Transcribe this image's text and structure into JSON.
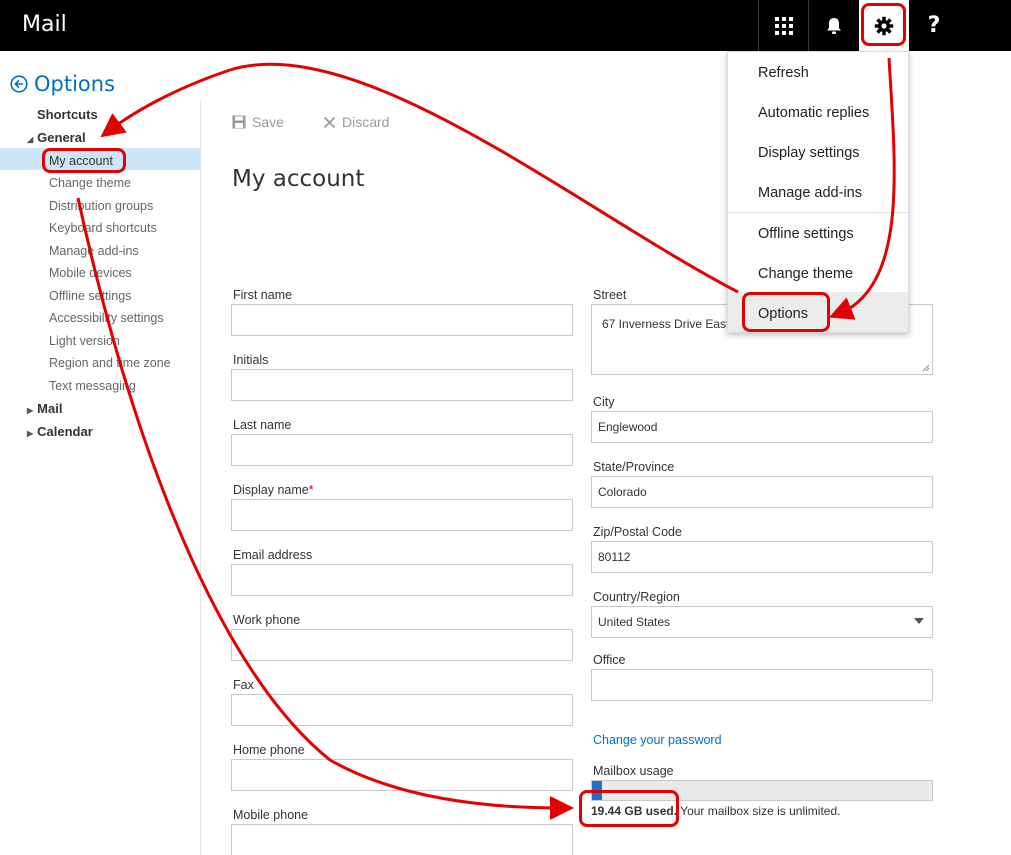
{
  "app": {
    "title": "Mail"
  },
  "topbar": {
    "apps_icon": "app-launcher-icon",
    "notifications_icon": "bell-icon",
    "settings_icon": "gear-icon",
    "help_label": "?"
  },
  "options_header": {
    "label": "Options"
  },
  "nav": {
    "shortcuts": "Shortcuts",
    "general": "General",
    "general_items": [
      "My account",
      "Change theme",
      "Distribution groups",
      "Keyboard shortcuts",
      "Manage add-ins",
      "Mobile devices",
      "Offline settings",
      "Accessibility settings",
      "Light version",
      "Region and time zone",
      "Text messaging"
    ],
    "mail": "Mail",
    "calendar": "Calendar"
  },
  "toolbar": {
    "save_label": "Save",
    "discard_label": "Discard"
  },
  "page": {
    "title": "My account"
  },
  "form_left": {
    "first_name": {
      "label": "First name",
      "value": ""
    },
    "initials": {
      "label": "Initials",
      "value": ""
    },
    "last_name": {
      "label": "Last name",
      "value": ""
    },
    "display_name": {
      "label": "Display name",
      "required_mark": "*",
      "value": ""
    },
    "email": {
      "label": "Email address",
      "value": ""
    },
    "work_phone": {
      "label": "Work phone",
      "value": ""
    },
    "fax": {
      "label": "Fax",
      "value": ""
    },
    "home_phone": {
      "label": "Home phone",
      "value": ""
    },
    "mobile_phone": {
      "label": "Mobile phone",
      "value": ""
    }
  },
  "form_right": {
    "street": {
      "label": "Street",
      "value": "67 Inverness Drive East"
    },
    "city": {
      "label": "City",
      "value": "Englewood"
    },
    "state": {
      "label": "State/Province",
      "value": "Colorado"
    },
    "zip": {
      "label": "Zip/Postal Code",
      "value": "80112"
    },
    "country": {
      "label": "Country/Region",
      "value": "United States"
    },
    "office": {
      "label": "Office",
      "value": ""
    },
    "change_password": "Change your password",
    "mailbox_usage_label": "Mailbox usage",
    "mailbox_used": "19.44 GB used.",
    "mailbox_unlimited": "Your mailbox size is unlimited.",
    "mailbox_usage_fraction": 0.03
  },
  "settings_menu": {
    "items": [
      "Refresh",
      "Automatic replies",
      "Display settings",
      "Manage add-ins",
      "Offline settings",
      "Change theme",
      "Options"
    ]
  },
  "colors": {
    "accent": "#0072c6",
    "annotation": "#e30000",
    "topbar": "#000000",
    "selected_nav": "#cde6f7",
    "usage_fill": "#1f6fd1"
  }
}
